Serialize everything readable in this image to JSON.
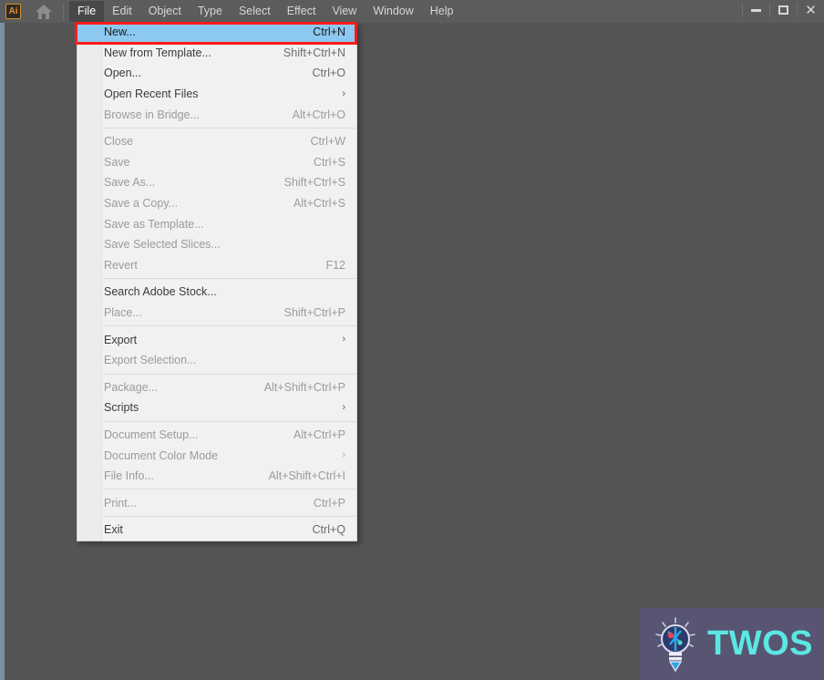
{
  "app": {
    "name": "Adobe Illustrator",
    "logo_text": "Ai",
    "background_color": "#545455",
    "accent_color": "#8dc8f0",
    "annotation_color": "#ff1b1b"
  },
  "menubar": {
    "items": [
      {
        "label": "File",
        "active": true
      },
      {
        "label": "Edit",
        "active": false
      },
      {
        "label": "Object",
        "active": false
      },
      {
        "label": "Type",
        "active": false
      },
      {
        "label": "Select",
        "active": false
      },
      {
        "label": "Effect",
        "active": false
      },
      {
        "label": "View",
        "active": false
      },
      {
        "label": "Window",
        "active": false
      },
      {
        "label": "Help",
        "active": false
      }
    ]
  },
  "window_controls": {
    "minimize": "minimize-icon",
    "maximize": "maximize-icon",
    "close": "close-icon"
  },
  "file_menu": {
    "title": "File",
    "groups": [
      {
        "items": [
          {
            "label": "New...",
            "accel": "Ctrl+N",
            "enabled": true,
            "submenu": false,
            "highlighted": true
          },
          {
            "label": "New from Template...",
            "accel": "Shift+Ctrl+N",
            "enabled": true,
            "submenu": false,
            "highlighted": false
          },
          {
            "label": "Open...",
            "accel": "Ctrl+O",
            "enabled": true,
            "submenu": false,
            "highlighted": false
          },
          {
            "label": "Open Recent Files",
            "accel": "",
            "enabled": true,
            "submenu": true,
            "highlighted": false
          },
          {
            "label": "Browse in Bridge...",
            "accel": "Alt+Ctrl+O",
            "enabled": false,
            "submenu": false,
            "highlighted": false
          }
        ]
      },
      {
        "items": [
          {
            "label": "Close",
            "accel": "Ctrl+W",
            "enabled": false,
            "submenu": false,
            "highlighted": false
          },
          {
            "label": "Save",
            "accel": "Ctrl+S",
            "enabled": false,
            "submenu": false,
            "highlighted": false
          },
          {
            "label": "Save As...",
            "accel": "Shift+Ctrl+S",
            "enabled": false,
            "submenu": false,
            "highlighted": false
          },
          {
            "label": "Save a Copy...",
            "accel": "Alt+Ctrl+S",
            "enabled": false,
            "submenu": false,
            "highlighted": false
          },
          {
            "label": "Save as Template...",
            "accel": "",
            "enabled": false,
            "submenu": false,
            "highlighted": false
          },
          {
            "label": "Save Selected Slices...",
            "accel": "",
            "enabled": false,
            "submenu": false,
            "highlighted": false
          },
          {
            "label": "Revert",
            "accel": "F12",
            "enabled": false,
            "submenu": false,
            "highlighted": false
          }
        ]
      },
      {
        "items": [
          {
            "label": "Search Adobe Stock...",
            "accel": "",
            "enabled": true,
            "submenu": false,
            "highlighted": false
          },
          {
            "label": "Place...",
            "accel": "Shift+Ctrl+P",
            "enabled": false,
            "submenu": false,
            "highlighted": false
          }
        ]
      },
      {
        "items": [
          {
            "label": "Export",
            "accel": "",
            "enabled": true,
            "submenu": true,
            "highlighted": false
          },
          {
            "label": "Export Selection...",
            "accel": "",
            "enabled": false,
            "submenu": false,
            "highlighted": false
          }
        ]
      },
      {
        "items": [
          {
            "label": "Package...",
            "accel": "Alt+Shift+Ctrl+P",
            "enabled": false,
            "submenu": false,
            "highlighted": false
          },
          {
            "label": "Scripts",
            "accel": "",
            "enabled": true,
            "submenu": true,
            "highlighted": false
          }
        ]
      },
      {
        "items": [
          {
            "label": "Document Setup...",
            "accel": "Alt+Ctrl+P",
            "enabled": false,
            "submenu": false,
            "highlighted": false
          },
          {
            "label": "Document Color Mode",
            "accel": "",
            "enabled": false,
            "submenu": true,
            "highlighted": false
          },
          {
            "label": "File Info...",
            "accel": "Alt+Shift+Ctrl+I",
            "enabled": false,
            "submenu": false,
            "highlighted": false
          }
        ]
      },
      {
        "items": [
          {
            "label": "Print...",
            "accel": "Ctrl+P",
            "enabled": false,
            "submenu": false,
            "highlighted": false
          }
        ]
      },
      {
        "items": [
          {
            "label": "Exit",
            "accel": "Ctrl+Q",
            "enabled": true,
            "submenu": false,
            "highlighted": false
          }
        ]
      }
    ]
  },
  "watermark": {
    "text": "TWOS",
    "icon": "lightbulb-icon",
    "text_color": "#5ae8e3",
    "background_color": "#585572"
  }
}
